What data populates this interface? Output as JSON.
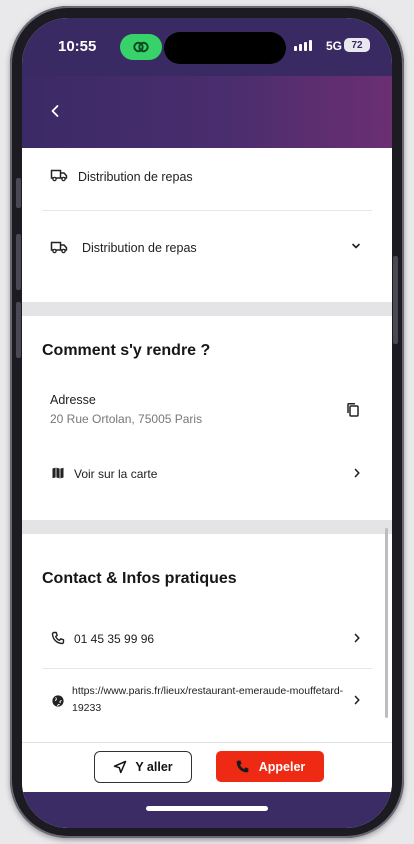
{
  "status_bar": {
    "time": "10:55",
    "network": "5G",
    "battery": "72"
  },
  "services": {
    "item_1": "Distribution de repas",
    "item_2": "Distribution de repas"
  },
  "directions": {
    "title": "Comment s'y rendre ?",
    "address_label": "Adresse",
    "address_value": "20 Rue Ortolan, 75005 Paris",
    "map_link": "Voir sur la carte"
  },
  "contact": {
    "title": "Contact & Infos pratiques",
    "phone": "01 45 35 99 96",
    "website": "https://www.paris.fr/lieux/restaurant-emeraude-mouffetard-19233"
  },
  "actions": {
    "go_label": "Y aller",
    "call_label": "Appeler"
  },
  "colors": {
    "header": "#3b2a66",
    "call_button": "#ef2a14",
    "status_app": "#37d36a"
  },
  "icons": [
    "back-chevron-icon",
    "truck-icon",
    "chevron-down-icon",
    "copy-icon",
    "map-icon",
    "chevron-right-icon",
    "phone-icon",
    "globe-icon",
    "navigation-arrow-icon"
  ]
}
